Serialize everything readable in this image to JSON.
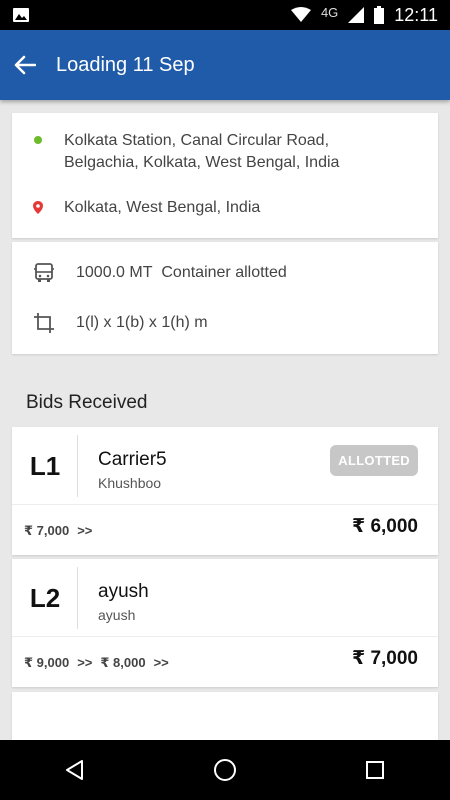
{
  "status_bar": {
    "network": "4G",
    "time": "12:11"
  },
  "app_bar": {
    "title": "Loading 11 Sep"
  },
  "route": {
    "origin": "Kolkata Station, Canal Circular Road, Belgachia, Kolkata, West Bengal, India",
    "destination": "Kolkata, West Bengal, India",
    "origin_color": "#6dbb2b",
    "destination_color": "#e53935"
  },
  "load": {
    "quantity": "1000.0 MT",
    "vehicle": "Container allotted",
    "dimensions": "1(l) x 1(b) x 1(h) m"
  },
  "bids_title": "Bids Received",
  "bids": [
    {
      "rank": "L1",
      "carrier": "Carrier5",
      "sub": "Khushboo",
      "badge": "ALLOTTED",
      "history": [
        "₹ 7,000",
        ">>"
      ],
      "amount": "₹ 6,000"
    },
    {
      "rank": "L2",
      "carrier": "ayush",
      "sub": "ayush",
      "history": [
        "₹ 9,000",
        ">>",
        "₹ 8,000",
        ">>"
      ],
      "amount": "₹ 7,000"
    }
  ]
}
